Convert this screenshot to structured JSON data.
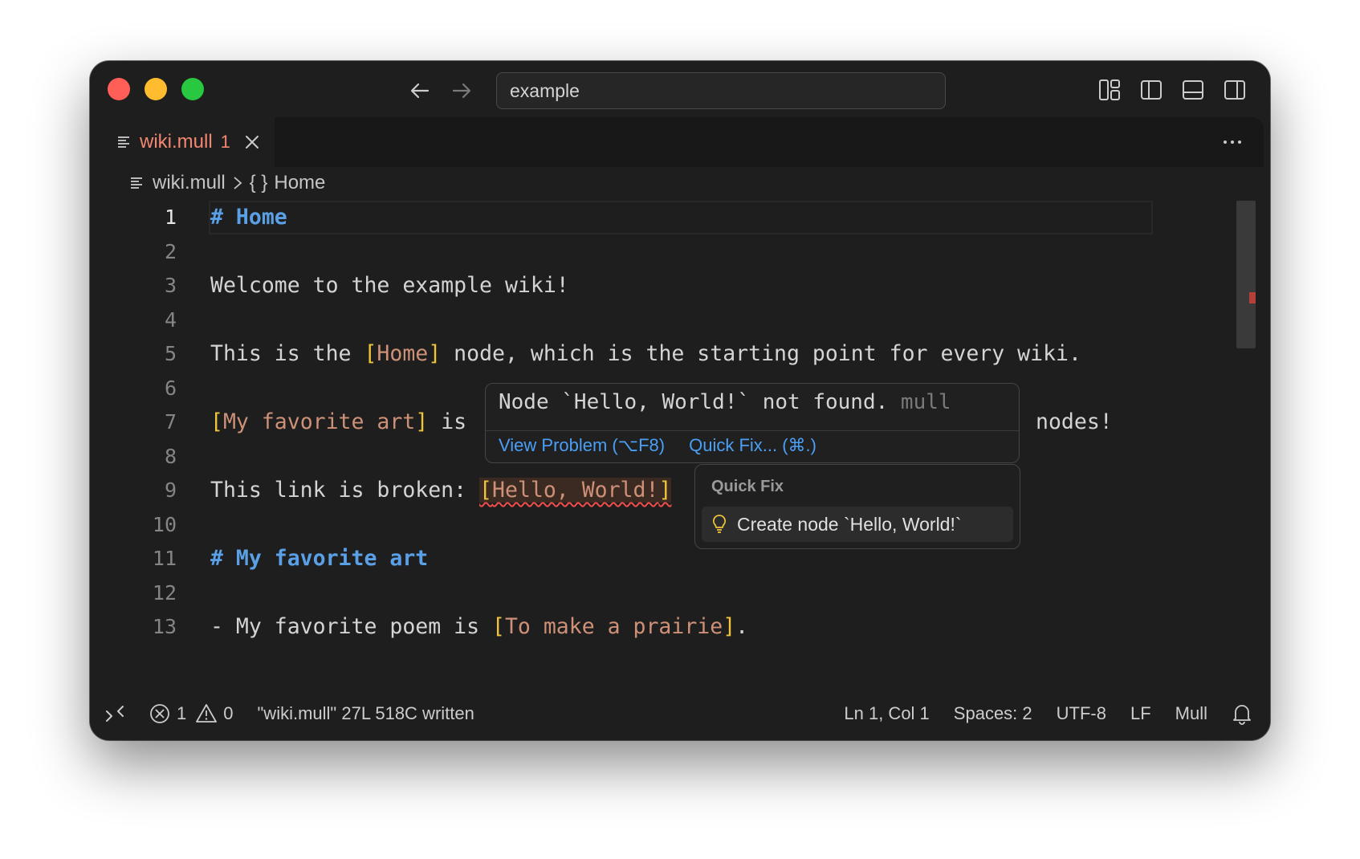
{
  "titlebar": {
    "search_value": "example"
  },
  "tab": {
    "label": "wiki.mull",
    "problem_count": "1"
  },
  "breadcrumb": {
    "file": "wiki.mull",
    "symbol": "Home",
    "symbol_icon": "{ }"
  },
  "editor": {
    "line_numbers": [
      "1",
      "2",
      "3",
      "4",
      "5",
      "6",
      "7",
      "8",
      "9",
      "10",
      "11",
      "12",
      "13"
    ],
    "lines": {
      "l1": {
        "heading": "# Home"
      },
      "l3": {
        "text": "Welcome to the example wiki!"
      },
      "l5": {
        "pre": "This is the ",
        "ob": "[",
        "link": "Home",
        "cb": "]",
        "post": " node, which is the starting point for every wiki."
      },
      "l7": {
        "ob": "[",
        "link": "My favorite art",
        "cb": "]",
        "post": " is",
        "tail": "nodes!"
      },
      "l9": {
        "pre": "This link is broken: ",
        "ob": "[",
        "link": "Hello, World!",
        "cb": "]"
      },
      "l11": {
        "heading": "# My favorite art"
      },
      "l13": {
        "pre": "- My favorite poem is ",
        "ob": "[",
        "link": "To make a prairie",
        "cb": "]",
        "post": "."
      }
    }
  },
  "hover": {
    "message": "Node `Hello, World!` not found.",
    "source": "mull",
    "view_problem": "View Problem (⌥F8)",
    "quick_fix": "Quick Fix... (⌘.)"
  },
  "quick_fix_menu": {
    "title": "Quick Fix",
    "item": "Create node `Hello, World!`"
  },
  "status": {
    "errors": "1",
    "warnings": "0",
    "message": "\"wiki.mull\" 27L 518C written",
    "position": "Ln 1, Col 1",
    "indent": "Spaces: 2",
    "encoding": "UTF-8",
    "eol": "LF",
    "language": "Mull"
  },
  "colors": {
    "heading": "#5aa0e6",
    "bracket": "#f0c43a",
    "link": "#ce9178",
    "error": "#f14c4c",
    "tab_error": "#f48771",
    "action_link": "#4a9ff5"
  }
}
